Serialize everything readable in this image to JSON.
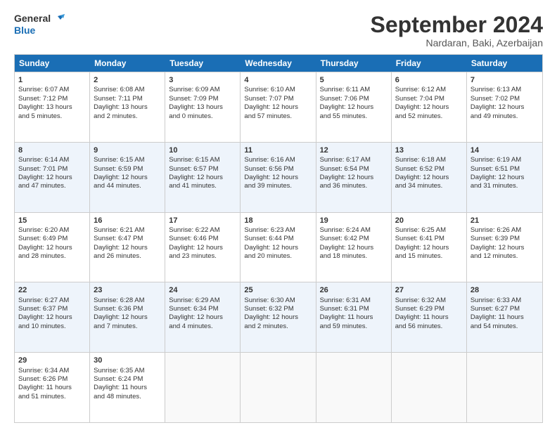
{
  "logo": {
    "line1": "General",
    "line2": "Blue"
  },
  "title": "September 2024",
  "subtitle": "Nardaran, Baki, Azerbaijan",
  "header_days": [
    "Sunday",
    "Monday",
    "Tuesday",
    "Wednesday",
    "Thursday",
    "Friday",
    "Saturday"
  ],
  "rows": [
    [
      {
        "day": "1",
        "lines": [
          "Sunrise: 6:07 AM",
          "Sunset: 7:12 PM",
          "Daylight: 13 hours",
          "and 5 minutes."
        ]
      },
      {
        "day": "2",
        "lines": [
          "Sunrise: 6:08 AM",
          "Sunset: 7:11 PM",
          "Daylight: 13 hours",
          "and 2 minutes."
        ]
      },
      {
        "day": "3",
        "lines": [
          "Sunrise: 6:09 AM",
          "Sunset: 7:09 PM",
          "Daylight: 13 hours",
          "and 0 minutes."
        ]
      },
      {
        "day": "4",
        "lines": [
          "Sunrise: 6:10 AM",
          "Sunset: 7:07 PM",
          "Daylight: 12 hours",
          "and 57 minutes."
        ]
      },
      {
        "day": "5",
        "lines": [
          "Sunrise: 6:11 AM",
          "Sunset: 7:06 PM",
          "Daylight: 12 hours",
          "and 55 minutes."
        ]
      },
      {
        "day": "6",
        "lines": [
          "Sunrise: 6:12 AM",
          "Sunset: 7:04 PM",
          "Daylight: 12 hours",
          "and 52 minutes."
        ]
      },
      {
        "day": "7",
        "lines": [
          "Sunrise: 6:13 AM",
          "Sunset: 7:02 PM",
          "Daylight: 12 hours",
          "and 49 minutes."
        ]
      }
    ],
    [
      {
        "day": "8",
        "lines": [
          "Sunrise: 6:14 AM",
          "Sunset: 7:01 PM",
          "Daylight: 12 hours",
          "and 47 minutes."
        ]
      },
      {
        "day": "9",
        "lines": [
          "Sunrise: 6:15 AM",
          "Sunset: 6:59 PM",
          "Daylight: 12 hours",
          "and 44 minutes."
        ]
      },
      {
        "day": "10",
        "lines": [
          "Sunrise: 6:15 AM",
          "Sunset: 6:57 PM",
          "Daylight: 12 hours",
          "and 41 minutes."
        ]
      },
      {
        "day": "11",
        "lines": [
          "Sunrise: 6:16 AM",
          "Sunset: 6:56 PM",
          "Daylight: 12 hours",
          "and 39 minutes."
        ]
      },
      {
        "day": "12",
        "lines": [
          "Sunrise: 6:17 AM",
          "Sunset: 6:54 PM",
          "Daylight: 12 hours",
          "and 36 minutes."
        ]
      },
      {
        "day": "13",
        "lines": [
          "Sunrise: 6:18 AM",
          "Sunset: 6:52 PM",
          "Daylight: 12 hours",
          "and 34 minutes."
        ]
      },
      {
        "day": "14",
        "lines": [
          "Sunrise: 6:19 AM",
          "Sunset: 6:51 PM",
          "Daylight: 12 hours",
          "and 31 minutes."
        ]
      }
    ],
    [
      {
        "day": "15",
        "lines": [
          "Sunrise: 6:20 AM",
          "Sunset: 6:49 PM",
          "Daylight: 12 hours",
          "and 28 minutes."
        ]
      },
      {
        "day": "16",
        "lines": [
          "Sunrise: 6:21 AM",
          "Sunset: 6:47 PM",
          "Daylight: 12 hours",
          "and 26 minutes."
        ]
      },
      {
        "day": "17",
        "lines": [
          "Sunrise: 6:22 AM",
          "Sunset: 6:46 PM",
          "Daylight: 12 hours",
          "and 23 minutes."
        ]
      },
      {
        "day": "18",
        "lines": [
          "Sunrise: 6:23 AM",
          "Sunset: 6:44 PM",
          "Daylight: 12 hours",
          "and 20 minutes."
        ]
      },
      {
        "day": "19",
        "lines": [
          "Sunrise: 6:24 AM",
          "Sunset: 6:42 PM",
          "Daylight: 12 hours",
          "and 18 minutes."
        ]
      },
      {
        "day": "20",
        "lines": [
          "Sunrise: 6:25 AM",
          "Sunset: 6:41 PM",
          "Daylight: 12 hours",
          "and 15 minutes."
        ]
      },
      {
        "day": "21",
        "lines": [
          "Sunrise: 6:26 AM",
          "Sunset: 6:39 PM",
          "Daylight: 12 hours",
          "and 12 minutes."
        ]
      }
    ],
    [
      {
        "day": "22",
        "lines": [
          "Sunrise: 6:27 AM",
          "Sunset: 6:37 PM",
          "Daylight: 12 hours",
          "and 10 minutes."
        ]
      },
      {
        "day": "23",
        "lines": [
          "Sunrise: 6:28 AM",
          "Sunset: 6:36 PM",
          "Daylight: 12 hours",
          "and 7 minutes."
        ]
      },
      {
        "day": "24",
        "lines": [
          "Sunrise: 6:29 AM",
          "Sunset: 6:34 PM",
          "Daylight: 12 hours",
          "and 4 minutes."
        ]
      },
      {
        "day": "25",
        "lines": [
          "Sunrise: 6:30 AM",
          "Sunset: 6:32 PM",
          "Daylight: 12 hours",
          "and 2 minutes."
        ]
      },
      {
        "day": "26",
        "lines": [
          "Sunrise: 6:31 AM",
          "Sunset: 6:31 PM",
          "Daylight: 11 hours",
          "and 59 minutes."
        ]
      },
      {
        "day": "27",
        "lines": [
          "Sunrise: 6:32 AM",
          "Sunset: 6:29 PM",
          "Daylight: 11 hours",
          "and 56 minutes."
        ]
      },
      {
        "day": "28",
        "lines": [
          "Sunrise: 6:33 AM",
          "Sunset: 6:27 PM",
          "Daylight: 11 hours",
          "and 54 minutes."
        ]
      }
    ],
    [
      {
        "day": "29",
        "lines": [
          "Sunrise: 6:34 AM",
          "Sunset: 6:26 PM",
          "Daylight: 11 hours",
          "and 51 minutes."
        ]
      },
      {
        "day": "30",
        "lines": [
          "Sunrise: 6:35 AM",
          "Sunset: 6:24 PM",
          "Daylight: 11 hours",
          "and 48 minutes."
        ]
      },
      {
        "day": "",
        "lines": [],
        "empty": true
      },
      {
        "day": "",
        "lines": [],
        "empty": true
      },
      {
        "day": "",
        "lines": [],
        "empty": true
      },
      {
        "day": "",
        "lines": [],
        "empty": true
      },
      {
        "day": "",
        "lines": [],
        "empty": true
      }
    ]
  ]
}
